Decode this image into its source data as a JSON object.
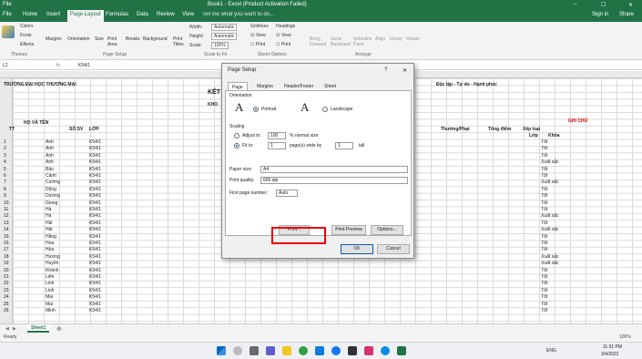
{
  "titlebar": {
    "menu": "File",
    "title": "Book1 - Excel (Product Activation Failed)",
    "search": "Tell me what you want to do...",
    "signin": "Sign in",
    "share": "Share"
  },
  "ribbon": {
    "tabs": [
      "File",
      "Home",
      "Insert",
      "Page Layout",
      "Formulas",
      "Data",
      "Review",
      "View"
    ],
    "active_tab": "Page Layout",
    "themes": {
      "colors": "Colors",
      "fonts": "Fonts",
      "effects": "Effects",
      "label": "Themes"
    },
    "page_setup": {
      "margins": "Margins",
      "orientation": "Orientation",
      "size": "Size",
      "print_area": "Print Area",
      "breaks": "Breaks",
      "background": "Background",
      "print_titles": "Print Titles",
      "label": "Page Setup"
    },
    "scale": {
      "width_label": "Width:",
      "width_val": "Automatic",
      "height_label": "Height:",
      "height_val": "Automatic",
      "scale_label": "Scale:",
      "scale_val": "100%",
      "label": "Scale to Fit"
    },
    "sheet_options": {
      "gridlines": "Gridlines",
      "headings": "Headings",
      "view1": "View",
      "view2": "View",
      "print1": "Print",
      "print2": "Print",
      "label": "Sheet Options"
    },
    "arrange": {
      "bring": "Bring Forward",
      "send": "Send Backward",
      "selection": "Selection Pane",
      "align": "Align",
      "group": "Group",
      "rotate": "Rotate",
      "label": "Arrange"
    }
  },
  "formula_bar": {
    "name_box": "L2",
    "value": "K54/1"
  },
  "sheet": {
    "title_left": "TRƯỜNG ĐẠI HỌC THƯƠNG MẠI",
    "title_right": "Độc lập - Tự do - Hạnh phúc",
    "ket": "KẾT",
    "kho": "KHO",
    "hdr_tt": "TT",
    "hdr_name": "HỌ VÀ TÊN",
    "hdr_sv": "SỐ SV",
    "hdr_lop": "LỚP",
    "hdr_thuong_phat": "Thưởng/Phạt",
    "hdr_tong": "Tổng điểm",
    "hdr_xep": "Xếp loại",
    "hdr_lop2": "Lớp",
    "hdr_khoa": "Khóa",
    "hdr_ghichu": "GHI CHÚ",
    "names": [
      "Anh",
      "Anh",
      "Anh",
      "Anh",
      "Bảo",
      "Cảnh",
      "Cường",
      "Dũng",
      "Dương",
      "Giang",
      "Hà",
      "Hà",
      "Hải",
      "Hải",
      "Hằng",
      "Hoa",
      "Hòa",
      "Hương",
      "Huyền",
      "Khánh",
      "Liên",
      "Linh",
      "Linh",
      "Mai",
      "Mai",
      "Minh"
    ],
    "grades": [
      "Tốt",
      "Tốt",
      "Tốt",
      "Xuất sắc",
      "Tốt",
      "Tốt",
      "Xuất sắc",
      "Tốt",
      "Tốt",
      "Tốt",
      "Tốt",
      "Xuất sắc",
      "Tốt",
      "Xuất sắc",
      "Tốt",
      "Tốt",
      "Tốt",
      "Xuất sắc",
      "Xuất sắc",
      "Tốt",
      "Tốt",
      "Tốt",
      "Tốt",
      "Tốt",
      "Tốt",
      "Tốt"
    ],
    "lop": "K54/1"
  },
  "sheet_tab": "Sheet1",
  "status": {
    "ready": "Ready",
    "zoom": "100%"
  },
  "taskbar": {
    "lang": "ENG",
    "time": "11:31 PM",
    "date": "3/4/2022"
  },
  "dialog": {
    "title": "Page Setup",
    "help": "?",
    "close": "✕",
    "tabs": [
      "Page",
      "Margins",
      "Header/Footer",
      "Sheet"
    ],
    "orientation_label": "Orientation",
    "portrait": "Portrait",
    "landscape": "Landscape",
    "scaling_label": "Scaling",
    "adjust_to": "Adjust to:",
    "adjust_val": "100",
    "normal_size": "% normal size",
    "fit_to": "Fit to:",
    "fit_wide": "1",
    "pages_wide": "page(s) wide by",
    "fit_tall": "1",
    "tall": "tall",
    "paper_size_label": "Paper size:",
    "paper_size": "A4",
    "print_quality_label": "Print quality:",
    "print_quality": "600 dpi",
    "first_page_label": "First page number:",
    "first_page": "Auto",
    "print_btn": "Print...",
    "preview_btn": "Print Preview",
    "options_btn": "Options...",
    "ok": "OK",
    "cancel": "Cancel"
  }
}
